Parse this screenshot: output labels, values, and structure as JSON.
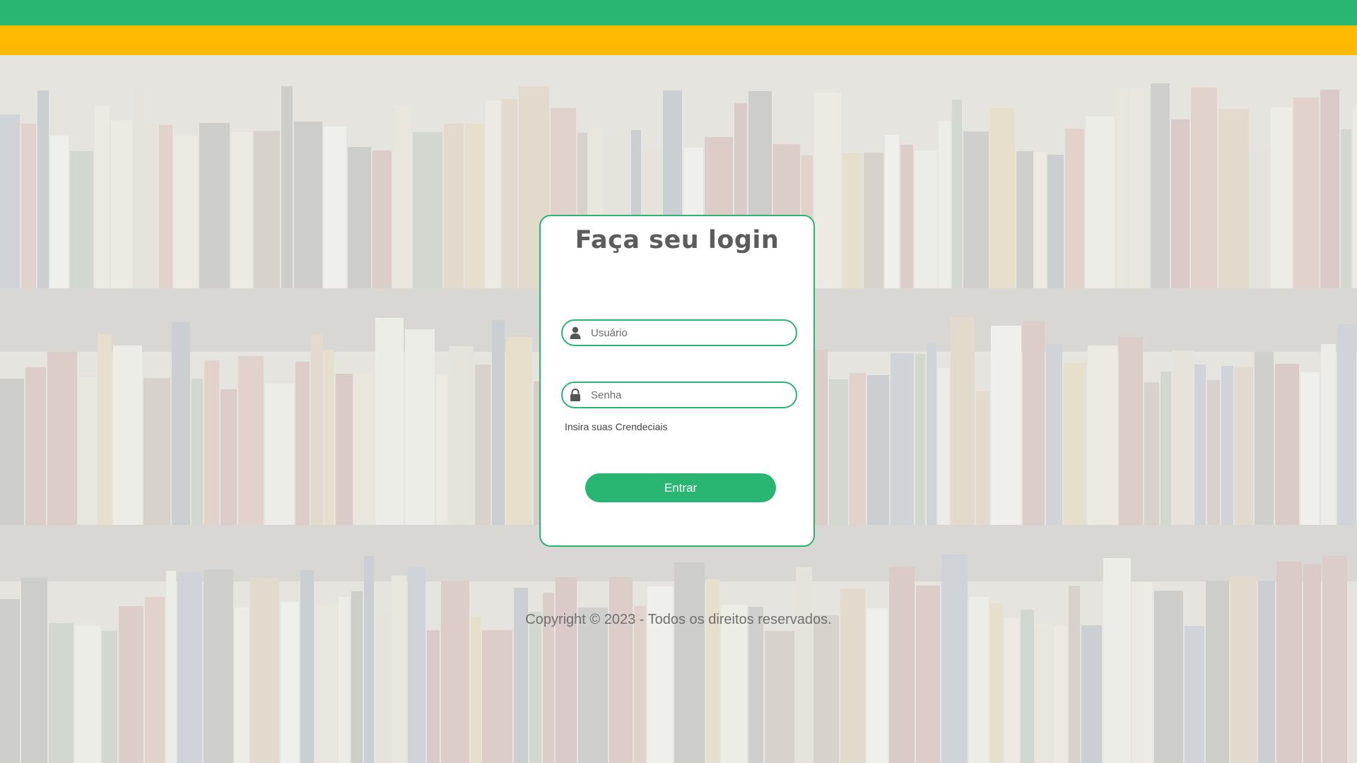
{
  "colors": {
    "green": "#29b673",
    "yellow": "#ffba00",
    "title_text": "#5c5c5c",
    "footer_text": "#707070"
  },
  "login": {
    "title": "Faça seu login",
    "username": {
      "value": "",
      "placeholder": "Usuário",
      "icon": "user-icon"
    },
    "password": {
      "value": "",
      "placeholder": "Senha",
      "icon": "lock-icon"
    },
    "hint": "Insira suas Crendeciais",
    "submit_label": "Entrar"
  },
  "footer": {
    "copyright": "Copyright © 2023 - Todos os direitos reservados."
  }
}
